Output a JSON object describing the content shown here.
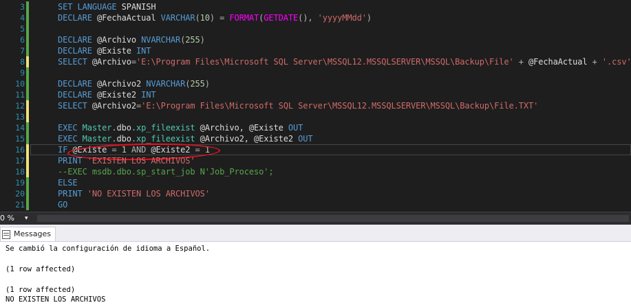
{
  "editor": {
    "line_numbers": [
      "3",
      "4",
      "5",
      "6",
      "7",
      "8",
      "9",
      "10",
      "11",
      "12",
      "13",
      "14",
      "15",
      "16",
      "17",
      "18",
      "19",
      "20",
      "21"
    ],
    "lines": {
      "l3": {
        "k1": "SET",
        "k2": "LANGUAGE",
        "p1": " SPANISH"
      },
      "l4": {
        "k1": "DECLARE",
        "p1": " @FechaActual ",
        "k2": "VARCHAR",
        "o1": "(",
        "n1": "10",
        "o2": ") = ",
        "f1": "FORMAT",
        "o3": "(",
        "f2": "GETDATE",
        "o4": "(), ",
        "s1": "'yyyyMMdd'",
        "o5": ")"
      },
      "l6": {
        "k1": "DECLARE",
        "p1": " @Archivo ",
        "k2": "NVARCHAR",
        "o1": "(",
        "n1": "255",
        "o2": ")"
      },
      "l7": {
        "k1": "DECLARE",
        "p1": " @Existe ",
        "k2": "INT"
      },
      "l8": {
        "k1": "SELECT",
        "p1": " @Archivo",
        "o1": "=",
        "s1": "'E:\\Program Files\\Microsoft SQL Server\\MSSQL12.MSSQLSERVER\\MSSQL\\Backup\\File'",
        "o2": " + ",
        "p2": "@FechaActual",
        "o3": " + ",
        "s2": "'.csv'"
      },
      "l10": {
        "k1": "DECLARE",
        "p1": " @Archivo2 ",
        "k2": "NVARCHAR",
        "o1": "(",
        "n1": "255",
        "o2": ")"
      },
      "l11": {
        "k1": "DECLARE",
        "p1": " @Existe2 ",
        "k2": "INT"
      },
      "l12": {
        "k1": "SELECT",
        "p1": " @Archivo2",
        "o1": "=",
        "s1": "'E:\\Program Files\\Microsoft SQL Server\\MSSQL12.MSSQLSERVER\\MSSQL\\Backup\\File.TXT'"
      },
      "l14": {
        "k1": "EXEC",
        "sy1": " Master",
        "o1": ".",
        "p1": "dbo",
        "o2": ".",
        "sy2": "xp_fileexist",
        "p2": " @Archivo, @Existe ",
        "k2": "OUT"
      },
      "l15": {
        "k1": "EXEC",
        "sy1": " Master",
        "o1": ".",
        "p1": "dbo",
        "o2": ".",
        "sy2": "xp_fileexist",
        "p2": " @Archivo2, @Existe2 ",
        "k2": "OUT"
      },
      "l16": {
        "k1": "IF",
        "p1": " @Existe ",
        "o1": "=",
        "n1": " 1 ",
        "o2": "AND",
        "p2": " @Existe2 ",
        "o3": "=",
        "n2": " 1"
      },
      "l17": {
        "k1": "PRINT",
        "s1": " 'EXISTEN LOS ARCHIVOS'"
      },
      "l18": {
        "c1": "--EXEC msdb.dbo.sp_start_job N'Job_Proceso';"
      },
      "l19": {
        "k1": "ELSE"
      },
      "l20": {
        "k1": "PRINT",
        "s1": " 'NO EXISTEN LOS ARCHIVOS'"
      },
      "l21": {
        "k1": "GO"
      }
    }
  },
  "statusbar": {
    "zoom": "0 %",
    "zoom_arrow": "▾"
  },
  "results": {
    "tab_label": "Messages",
    "messages": [
      "Se cambió la configuración de idioma a Español.",
      "",
      "(1 row affected)",
      "",
      "(1 row affected)",
      "NO EXISTEN LOS ARCHIVOS"
    ]
  },
  "colors": {
    "change_saved": "#57a64a",
    "change_unsaved": "#efe27a",
    "annotation": "#e81123"
  }
}
